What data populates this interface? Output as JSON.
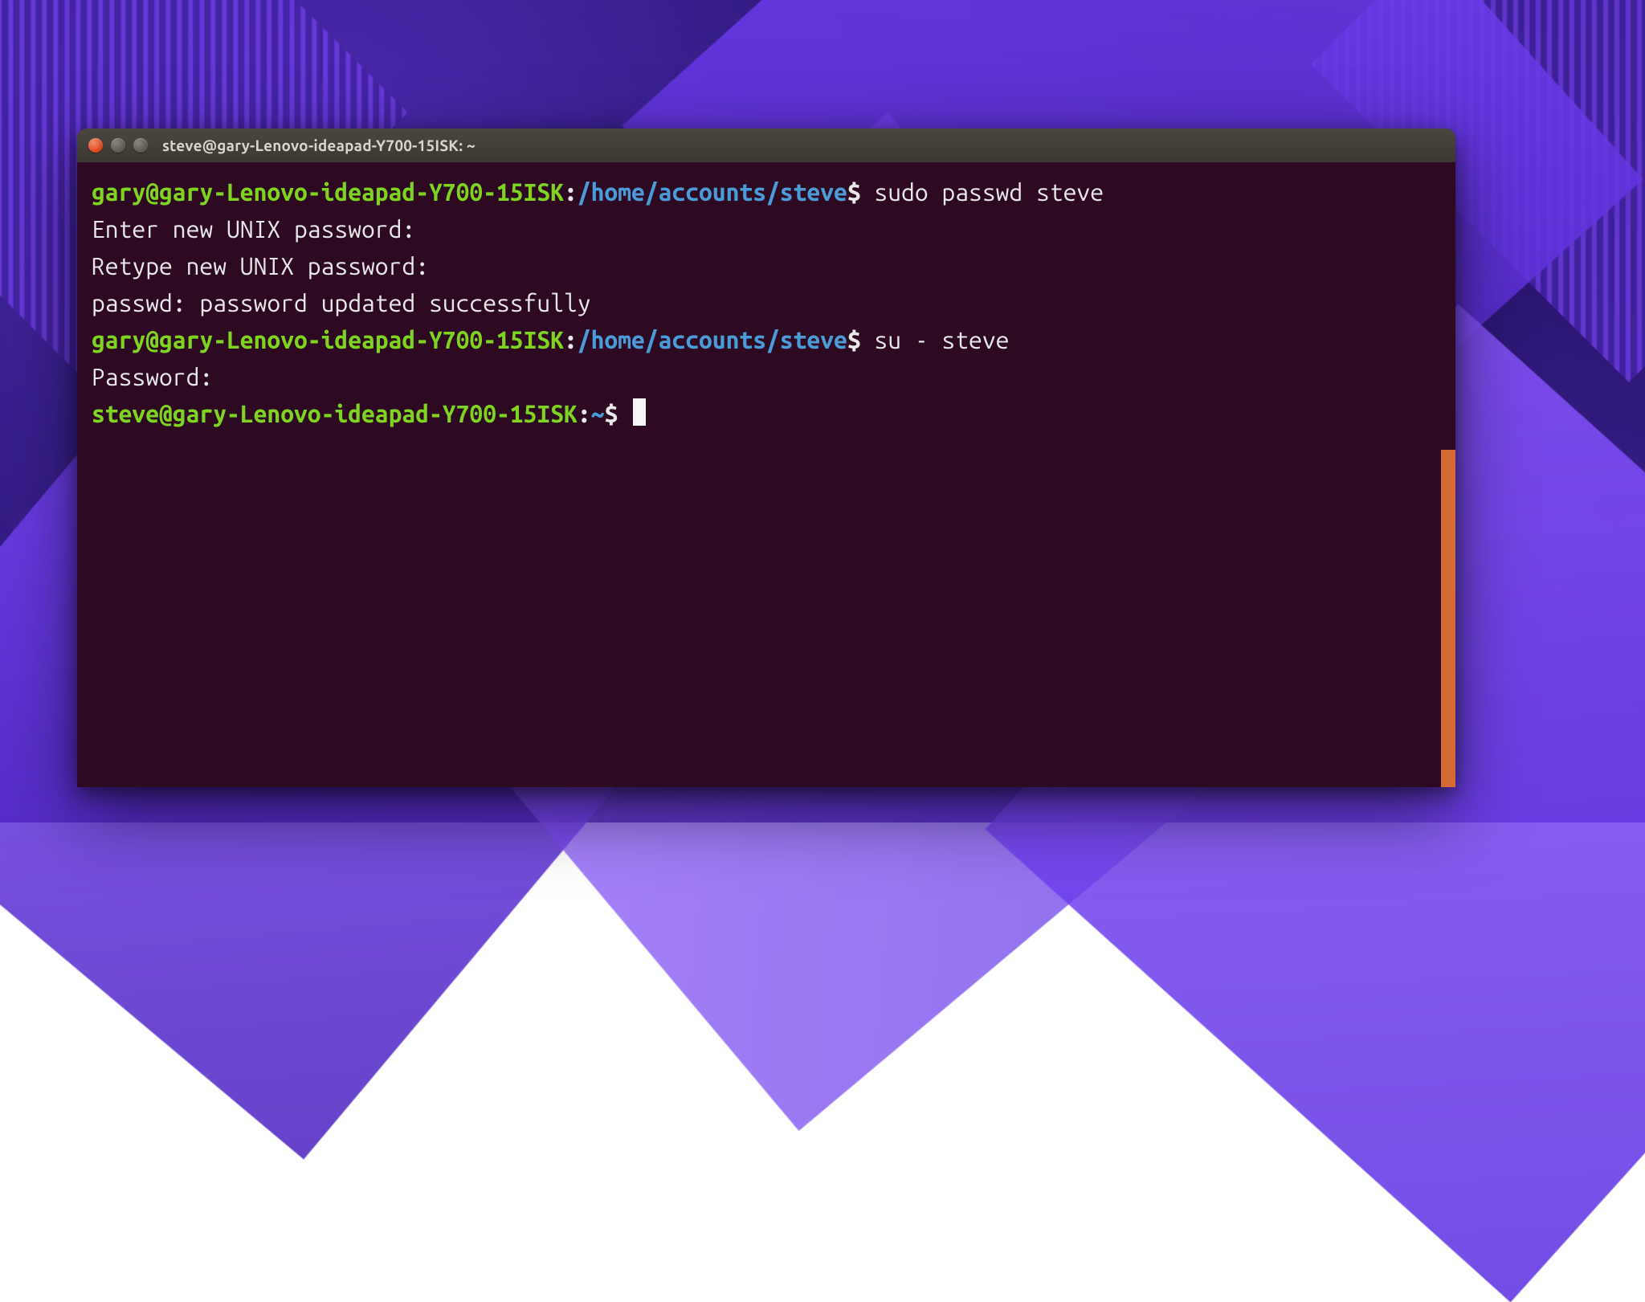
{
  "window": {
    "title": "steve@gary-Lenovo-ideapad-Y700-15ISK: ~"
  },
  "colors": {
    "term_bg": "#2d0a22",
    "prompt_user": "#7fd321",
    "prompt_path": "#4a9bd8",
    "text": "#e8e8e8",
    "scrollbar": "#f07d3a"
  },
  "lines": [
    {
      "user": "gary@gary-Lenovo-ideapad-Y700-15ISK",
      "sep": ":",
      "path": "/home/accounts/steve",
      "dollar": "$ ",
      "cmd": "sudo passwd steve"
    },
    {
      "out": "Enter new UNIX password: "
    },
    {
      "out": "Retype new UNIX password: "
    },
    {
      "out": "passwd: password updated successfully"
    },
    {
      "user": "gary@gary-Lenovo-ideapad-Y700-15ISK",
      "sep": ":",
      "path": "/home/accounts/steve",
      "dollar": "$ ",
      "cmd": "su - steve"
    },
    {
      "out": "Password: "
    },
    {
      "user": "steve@gary-Lenovo-ideapad-Y700-15ISK",
      "sep": ":",
      "path": "~",
      "dollar": "$ ",
      "cmd": "",
      "cursor": true
    }
  ]
}
